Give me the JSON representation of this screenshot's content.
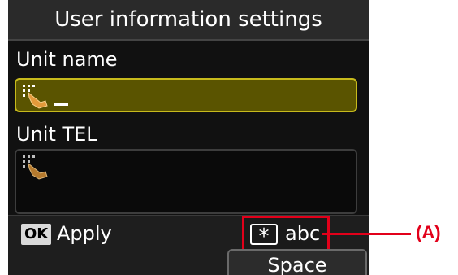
{
  "screen": {
    "title": "User information settings",
    "fields": [
      {
        "label": "Unit name",
        "value": "",
        "active": true
      },
      {
        "label": "Unit TEL",
        "value": "",
        "active": false
      }
    ],
    "footer": {
      "ok_key": "OK",
      "apply_label": "Apply",
      "mode_key": "*",
      "mode_label": "abc",
      "space_label": "Space"
    }
  },
  "annotation": {
    "callout_label": "(A)",
    "color": "#e2001a"
  },
  "colors": {
    "active_field_bg": "#5a5400",
    "active_field_border": "#c7ba1c",
    "screen_bg": "#111111"
  },
  "icons": [
    "touch-hand-icon",
    "asterisk-key-icon",
    "ok-key-icon"
  ]
}
